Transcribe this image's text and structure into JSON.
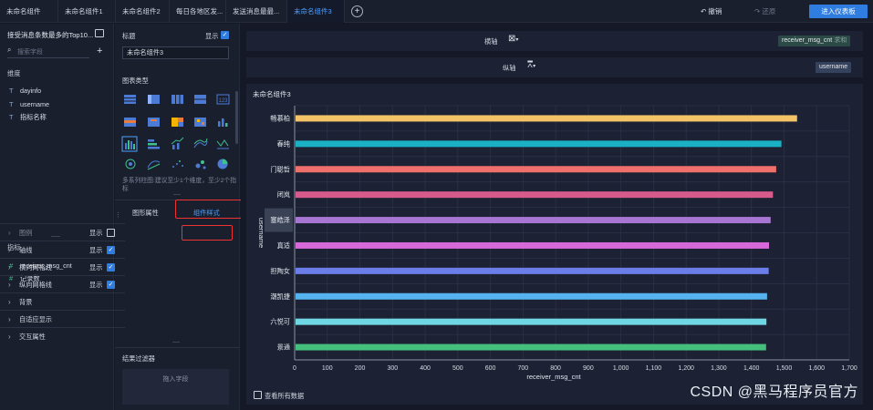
{
  "tabs": [
    "未命名组件",
    "未命名组件1",
    "未命名组件2",
    "每日各地区发...",
    "发送消息最最...",
    "未命名组件3"
  ],
  "active_tab": 5,
  "toolbar": {
    "undo": "撤销",
    "redo": "还原",
    "enter_dashboard": "进入仪表板"
  },
  "left": {
    "title": "接受消息条数最多的Top10...",
    "search_placeholder": "搜索字段",
    "dimension_header": "维度",
    "dimensions": [
      "dayinfo",
      "username",
      "指标名称"
    ],
    "metric_header": "指标",
    "metrics": [
      "receiver_msg_cnt",
      "记录数"
    ]
  },
  "middle": {
    "title_label": "标题",
    "title_show": "显示",
    "title_value": "未命名组件3",
    "chart_type_label": "图表类型",
    "hint": "多系列柱图:建议至少1个维度，至少2个指标",
    "tab_graph": "图形属性",
    "tab_style": "组件样式",
    "properties": [
      {
        "label": "图例",
        "show": "显示",
        "checked": false
      },
      {
        "label": "轴线",
        "show": "显示",
        "checked": true
      },
      {
        "label": "横向网格线",
        "show": "显示",
        "checked": true
      },
      {
        "label": "纵向网格线",
        "show": "显示",
        "checked": true
      },
      {
        "label": "背景",
        "show": "",
        "checked": null
      },
      {
        "label": "自适应显示",
        "show": "",
        "checked": null
      },
      {
        "label": "交互属性",
        "show": "",
        "checked": null
      }
    ],
    "filter_label": "结果过滤器",
    "drop_hint": "拖入字段"
  },
  "axes": {
    "horizontal_label": "横轴",
    "horizontal_pill": "receiver_msg_cnt",
    "horizontal_pill_suffix": "求和",
    "vertical_label": "纵轴",
    "vertical_pill": "username"
  },
  "show_all_data": "查看所有数据",
  "watermark": "CSDN @黑马程序员官方",
  "colors": {
    "accent": "#2f7de1",
    "active_tab": "#4ea0ff",
    "highlight_box": "#ee3333"
  },
  "chart_data": {
    "type": "bar",
    "orientation": "horizontal",
    "title": "未命名组件3",
    "xlabel": "receiver_msg_cnt",
    "ylabel": "username",
    "categories": [
      "畅慕柏",
      "春纯",
      "门聪哲",
      "闭岚",
      "塞皓泽",
      "真适",
      "担陶女",
      "潮凯捷",
      "六悦可",
      "景通"
    ],
    "values": [
      1540,
      1492,
      1476,
      1466,
      1459,
      1454,
      1453,
      1448,
      1446,
      1445
    ],
    "colors": [
      "#f5c367",
      "#1ab1c4",
      "#ef6f6c",
      "#d65a8c",
      "#a775d2",
      "#d668d8",
      "#6a7de9",
      "#55b4f0",
      "#6fd6e3",
      "#45bf7c"
    ],
    "xlim": [
      0,
      1700
    ],
    "xticks": [
      0,
      100,
      200,
      300,
      400,
      500,
      600,
      700,
      800,
      900,
      1000,
      1100,
      1200,
      1300,
      1400,
      1500,
      1600,
      1700
    ],
    "xtick_labels": [
      "0",
      "100",
      "200",
      "300",
      "400",
      "500",
      "600",
      "700",
      "800",
      "900",
      "1,000",
      "1,100",
      "1,200",
      "1,300",
      "1,400",
      "1,500",
      "1,600",
      "1,700"
    ],
    "grid": true,
    "legend": "hidden"
  }
}
